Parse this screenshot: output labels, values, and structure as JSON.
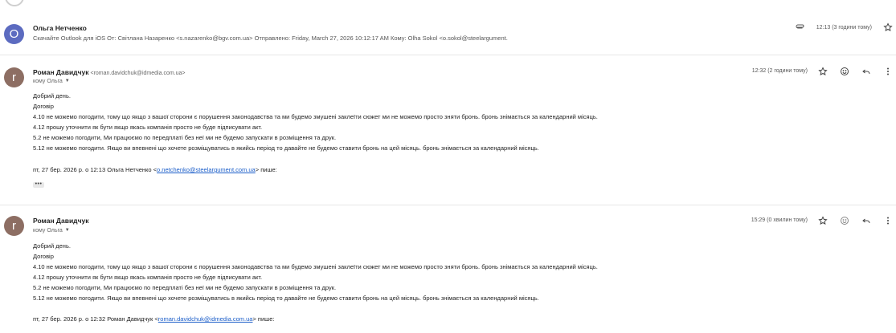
{
  "colors": {
    "avatar_o": "#5c6bc0",
    "avatar_r": "#8d6e63",
    "link": "#1a5dc9"
  },
  "message1": {
    "avatar_letter": "O",
    "sender_name": "Ольга Нетченко",
    "snippet": "Скачайте Outlook для iOS От: Світлана Назаренко <s.nazarenko@bgv.com.ua> Отправлено: Friday, March 27, 2026 10:12:17 AM Кому: Olha Sokol <o.sokol@steelargument.",
    "time": "12:13 (3 години тому)",
    "icons": [
      "attachment-icon",
      "star-icon"
    ]
  },
  "message2": {
    "avatar_letter": "r",
    "sender_name": "Роман Давидчук",
    "sender_email": "<roman.davidchuk@idmedia.com.ua>",
    "to_label": "кому Ольга",
    "time": "12:32 (2 години тому)",
    "icons": [
      "star-icon",
      "emoji-icon",
      "reply-icon",
      "more-icon"
    ],
    "body": [
      "Добрий день.",
      "Договір",
      "4.10 не можемо погодити, тому що якщо з вашої сторони є порушення законодавства та ми будемо змушені заклеїти сюжет ми не можемо просто зняти бронь. бронь знімається за календарний місяць.",
      "4.12 прошу уточнити як бути якщо якась компанія просто не буде підписувати акт.",
      "5.2  не можемо погодити, Ми працюємо по передплаті без неї ми не будемо запускати в розміщення та друк.",
      "5.12  не можемо погодити. Якщо ви впевнені що хочете розміщуватись в якийсь період то давайте не будемо ставити бронь на цей місяць. бронь знімається за календарний місяць."
    ],
    "quote_prefix": "пт, 27 бер. 2026 р. о 12:13 Ольга Нетченко <",
    "quote_email": "o.netchenko@steelargument.com.ua",
    "quote_suffix": "> пише:",
    "trimmed_label": "•••"
  },
  "message3": {
    "avatar_letter": "r",
    "sender_name": "Роман Давидчук",
    "to_label": "кому Ольга",
    "time": "15:29 (0 хвилин тому)",
    "icons": [
      "star-icon",
      "emoji-icon",
      "reply-icon",
      "more-icon"
    ],
    "body": [
      "Добрий день.",
      "Договір",
      "4.10 не можемо погодити, тому що якщо з вашої сторони є порушення законодавства та ми будемо змушені заклеїти сюжет ми не можемо просто зняти бронь. бронь знімається за календарний місяць.",
      "4.12 прошу уточнити як бути якщо якась компанія просто не буде підписувати акт.",
      "5.2  не можемо погодити, Ми працюємо по передплаті без неї ми не будемо запускати в розміщення та друк.",
      "5.12  не можемо погодити. Якщо ви впевнені що хочете розміщуватись в якийсь період то давайте не будемо ставити бронь на цей місяць. бронь знімається за календарний місяць."
    ],
    "quote_prefix": "пт, 27 бер. 2026 р. о 12:32 Роман Давидчук <",
    "quote_email": "roman.davidchuk@idmedia.com.ua",
    "quote_suffix": "> пише:"
  }
}
